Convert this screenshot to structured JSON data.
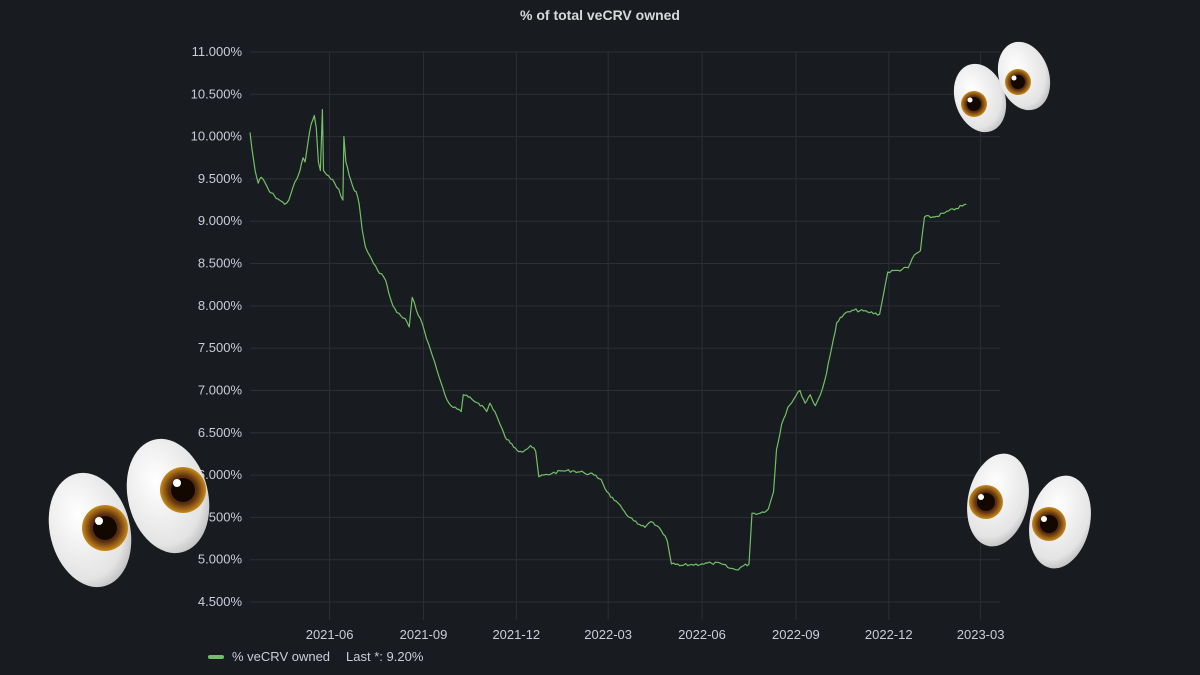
{
  "chart_data": {
    "type": "line",
    "title": "% of total veCRV owned",
    "xlabel": "",
    "ylabel": "",
    "x_ticks": [
      "2021-06",
      "2021-09",
      "2021-12",
      "2022-03",
      "2022-06",
      "2022-09",
      "2022-12",
      "2023-03"
    ],
    "y_ticks": [
      "4.500%",
      "5.000%",
      "5.500%",
      "6.000%",
      "6.500%",
      "7.000%",
      "7.500%",
      "8.000%",
      "8.500%",
      "9.000%",
      "9.500%",
      "10.000%",
      "10.500%",
      "11.000%"
    ],
    "ylim": [
      4.5,
      11.0
    ],
    "xlim": [
      "2021-03-15",
      "2023-03-20"
    ],
    "grid": true,
    "legend_position": "bottom-left",
    "series": [
      {
        "name": "% veCRV owned",
        "color": "#73bf69",
        "points": [
          [
            "2021-03-15",
            10.05
          ],
          [
            "2021-03-17",
            9.85
          ],
          [
            "2021-03-20",
            9.6
          ],
          [
            "2021-03-23",
            9.45
          ],
          [
            "2021-03-26",
            9.52
          ],
          [
            "2021-03-30",
            9.45
          ],
          [
            "2021-04-03",
            9.35
          ],
          [
            "2021-04-08",
            9.3
          ],
          [
            "2021-04-13",
            9.25
          ],
          [
            "2021-04-18",
            9.2
          ],
          [
            "2021-04-22",
            9.25
          ],
          [
            "2021-04-26",
            9.4
          ],
          [
            "2021-04-30",
            9.5
          ],
          [
            "2021-05-03",
            9.6
          ],
          [
            "2021-05-06",
            9.75
          ],
          [
            "2021-05-08",
            9.7
          ],
          [
            "2021-05-11",
            9.95
          ],
          [
            "2021-05-14",
            10.15
          ],
          [
            "2021-05-17",
            10.25
          ],
          [
            "2021-05-19",
            10.1
          ],
          [
            "2021-05-21",
            9.7
          ],
          [
            "2021-05-23",
            9.6
          ],
          [
            "2021-05-25",
            10.32
          ],
          [
            "2021-05-26",
            9.6
          ],
          [
            "2021-05-29",
            9.55
          ],
          [
            "2021-06-02",
            9.5
          ],
          [
            "2021-06-06",
            9.45
          ],
          [
            "2021-06-10",
            9.38
          ],
          [
            "2021-06-14",
            9.25
          ],
          [
            "2021-06-15",
            10.0
          ],
          [
            "2021-06-17",
            9.7
          ],
          [
            "2021-06-20",
            9.55
          ],
          [
            "2021-06-24",
            9.4
          ],
          [
            "2021-06-27",
            9.35
          ],
          [
            "2021-06-30",
            9.2
          ],
          [
            "2021-07-03",
            8.9
          ],
          [
            "2021-07-06",
            8.7
          ],
          [
            "2021-07-10",
            8.6
          ],
          [
            "2021-07-14",
            8.5
          ],
          [
            "2021-07-18",
            8.42
          ],
          [
            "2021-07-22",
            8.38
          ],
          [
            "2021-07-26",
            8.3
          ],
          [
            "2021-07-29",
            8.15
          ],
          [
            "2021-08-02",
            8.0
          ],
          [
            "2021-08-06",
            7.92
          ],
          [
            "2021-08-10",
            7.88
          ],
          [
            "2021-08-14",
            7.85
          ],
          [
            "2021-08-18",
            7.75
          ],
          [
            "2021-08-21",
            8.1
          ],
          [
            "2021-08-25",
            7.95
          ],
          [
            "2021-08-29",
            7.85
          ],
          [
            "2021-09-02",
            7.7
          ],
          [
            "2021-09-06",
            7.55
          ],
          [
            "2021-09-10",
            7.4
          ],
          [
            "2021-09-14",
            7.25
          ],
          [
            "2021-09-18",
            7.1
          ],
          [
            "2021-09-22",
            6.95
          ],
          [
            "2021-09-26",
            6.85
          ],
          [
            "2021-09-30",
            6.8
          ],
          [
            "2021-10-04",
            6.78
          ],
          [
            "2021-10-08",
            6.75
          ],
          [
            "2021-10-10",
            6.95
          ],
          [
            "2021-10-15",
            6.92
          ],
          [
            "2021-10-20",
            6.88
          ],
          [
            "2021-10-25",
            6.85
          ],
          [
            "2021-10-30",
            6.8
          ],
          [
            "2021-11-02",
            6.75
          ],
          [
            "2021-11-05",
            6.85
          ],
          [
            "2021-11-10",
            6.75
          ],
          [
            "2021-11-15",
            6.6
          ],
          [
            "2021-11-20",
            6.45
          ],
          [
            "2021-11-25",
            6.38
          ],
          [
            "2021-11-30",
            6.32
          ],
          [
            "2021-12-05",
            6.28
          ],
          [
            "2021-12-10",
            6.3
          ],
          [
            "2021-12-15",
            6.35
          ],
          [
            "2021-12-20",
            6.28
          ],
          [
            "2021-12-23",
            5.98
          ],
          [
            "2021-12-28",
            6.0
          ],
          [
            "2022-01-05",
            6.02
          ],
          [
            "2022-01-15",
            6.05
          ],
          [
            "2022-01-25",
            6.05
          ],
          [
            "2022-02-05",
            6.03
          ],
          [
            "2022-02-15",
            6.0
          ],
          [
            "2022-02-22",
            5.95
          ],
          [
            "2022-02-28",
            5.8
          ],
          [
            "2022-03-07",
            5.7
          ],
          [
            "2022-03-15",
            5.6
          ],
          [
            "2022-03-22",
            5.5
          ],
          [
            "2022-03-30",
            5.42
          ],
          [
            "2022-04-06",
            5.38
          ],
          [
            "2022-04-12",
            5.45
          ],
          [
            "2022-04-18",
            5.4
          ],
          [
            "2022-04-24",
            5.3
          ],
          [
            "2022-04-28",
            5.22
          ],
          [
            "2022-05-02",
            4.95
          ],
          [
            "2022-05-10",
            4.93
          ],
          [
            "2022-05-20",
            4.94
          ],
          [
            "2022-06-01",
            4.95
          ],
          [
            "2022-06-10",
            4.96
          ],
          [
            "2022-06-20",
            4.95
          ],
          [
            "2022-06-28",
            4.9
          ],
          [
            "2022-07-05",
            4.88
          ],
          [
            "2022-07-10",
            4.92
          ],
          [
            "2022-07-17",
            4.95
          ],
          [
            "2022-07-20",
            5.55
          ],
          [
            "2022-07-28",
            5.55
          ],
          [
            "2022-08-05",
            5.6
          ],
          [
            "2022-08-10",
            5.8
          ],
          [
            "2022-08-13",
            6.3
          ],
          [
            "2022-08-18",
            6.6
          ],
          [
            "2022-08-24",
            6.8
          ],
          [
            "2022-08-30",
            6.9
          ],
          [
            "2022-09-05",
            7.0
          ],
          [
            "2022-09-10",
            6.85
          ],
          [
            "2022-09-15",
            6.95
          ],
          [
            "2022-09-20",
            6.82
          ],
          [
            "2022-09-25",
            6.95
          ],
          [
            "2022-10-01",
            7.2
          ],
          [
            "2022-10-06",
            7.5
          ],
          [
            "2022-10-11",
            7.8
          ],
          [
            "2022-10-18",
            7.9
          ],
          [
            "2022-10-28",
            7.95
          ],
          [
            "2022-11-10",
            7.93
          ],
          [
            "2022-11-22",
            7.9
          ],
          [
            "2022-11-26",
            8.15
          ],
          [
            "2022-11-30",
            8.4
          ],
          [
            "2022-12-10",
            8.42
          ],
          [
            "2022-12-20",
            8.45
          ],
          [
            "2022-12-26",
            8.6
          ],
          [
            "2023-01-01",
            8.65
          ],
          [
            "2023-01-05",
            9.05
          ],
          [
            "2023-01-15",
            9.05
          ],
          [
            "2023-01-25",
            9.1
          ],
          [
            "2023-02-05",
            9.15
          ],
          [
            "2023-02-15",
            9.2
          ]
        ]
      }
    ]
  },
  "legend": {
    "series_label": "% veCRV owned",
    "last_value": "Last *: 9.20%"
  },
  "decorations": {
    "eyes_icon": "eyes-emoji-icon"
  }
}
